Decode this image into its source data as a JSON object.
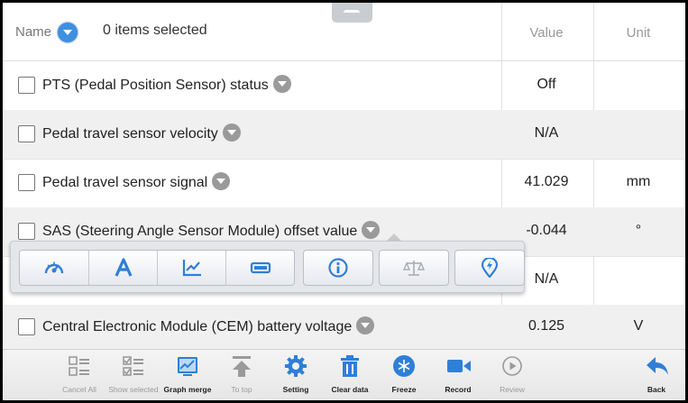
{
  "header": {
    "name_label": "Name",
    "selected_text": "0 items selected",
    "value_label": "Value",
    "unit_label": "Unit"
  },
  "rows": [
    {
      "name": "PTS (Pedal Position Sensor) status",
      "value": "Off",
      "unit": ""
    },
    {
      "name": "Pedal travel sensor velocity",
      "value": "N/A",
      "unit": ""
    },
    {
      "name": "Pedal travel sensor signal",
      "value": "41.029",
      "unit": "mm"
    },
    {
      "name": "SAS (Steering Angle Sensor Module) offset value",
      "value": "-0.044",
      "unit": "°"
    },
    {
      "name": "",
      "value": "N/A",
      "unit": ""
    },
    {
      "name": "Central Electronic Module (CEM) battery voltage",
      "value": "0.125",
      "unit": "V"
    }
  ],
  "popup": {
    "buttons": [
      "gauge-icon",
      "text-icon",
      "line-graph-icon",
      "digital-bar-icon",
      "info-icon",
      "balance-scale-icon",
      "map-pin-icon"
    ]
  },
  "toolbar": {
    "items": [
      {
        "label": "Cancel All",
        "icon": "list-icon",
        "enabled": false
      },
      {
        "label": "Show selected",
        "icon": "checklist-icon",
        "enabled": false
      },
      {
        "label": "Graph merge",
        "icon": "graph-merge-icon",
        "enabled": true
      },
      {
        "label": "To top",
        "icon": "to-top-icon",
        "enabled": false
      },
      {
        "label": "Setting",
        "icon": "gear-icon",
        "enabled": true
      },
      {
        "label": "Clear data",
        "icon": "trash-icon",
        "enabled": true
      },
      {
        "label": "Freeze",
        "icon": "snowflake-icon",
        "enabled": true
      },
      {
        "label": "Record",
        "icon": "video-camera-icon",
        "enabled": true
      },
      {
        "label": "Review",
        "icon": "play-icon",
        "enabled": false
      },
      {
        "label": "Back",
        "icon": "back-arrow-icon",
        "enabled": true
      }
    ]
  },
  "colors": {
    "accent_blue": "#3f8fe0",
    "icon_blue": "#2f7fd8",
    "disabled_gray": "#9a9a9a",
    "row_shade": "#f0f0f0"
  }
}
